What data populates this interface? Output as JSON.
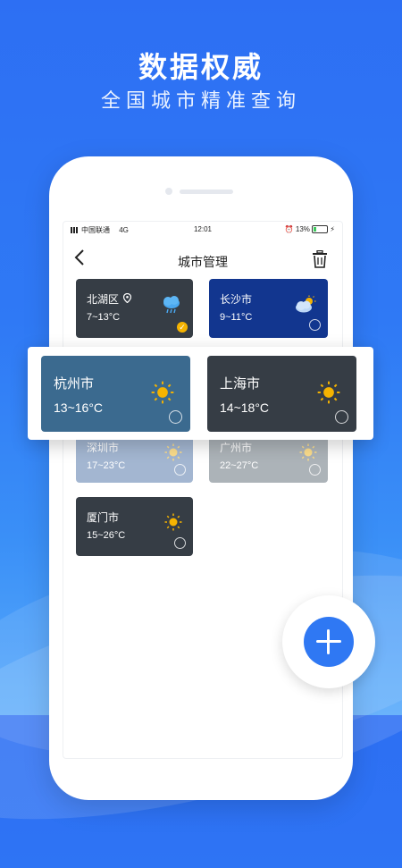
{
  "promo": {
    "headline": "数据权威",
    "subheadline": "全国城市精准查询"
  },
  "status_bar": {
    "carrier": "中国联通",
    "network": "4G",
    "time": "12:01",
    "battery": "13%"
  },
  "nav": {
    "title": "城市管理"
  },
  "cities": [
    {
      "name": "北湖区",
      "temp": "7~13°C",
      "icon": "rain-cloud-icon",
      "selected": true,
      "location": true
    },
    {
      "name": "长沙市",
      "temp": "9~11°C",
      "icon": "partly-cloudy-icon",
      "selected": false
    },
    {
      "name": "深圳市",
      "temp": "17~23°C",
      "icon": "sun-icon",
      "selected": false
    },
    {
      "name": "广州市",
      "temp": "22~27°C",
      "icon": "sun-icon",
      "selected": false
    },
    {
      "name": "厦门市",
      "temp": "15~26°C",
      "icon": "sun-icon",
      "selected": false
    }
  ],
  "highlight": [
    {
      "name": "杭州市",
      "temp": "13~16°C",
      "icon": "sun-icon"
    },
    {
      "name": "上海市",
      "temp": "14~18°C",
      "icon": "sun-icon"
    }
  ],
  "colors": {
    "background": "#2f79f5",
    "dark_card": "#363d45",
    "navy_card": "#12368f",
    "teal_card": "#3b6a8f",
    "accent": "#f5b301"
  }
}
